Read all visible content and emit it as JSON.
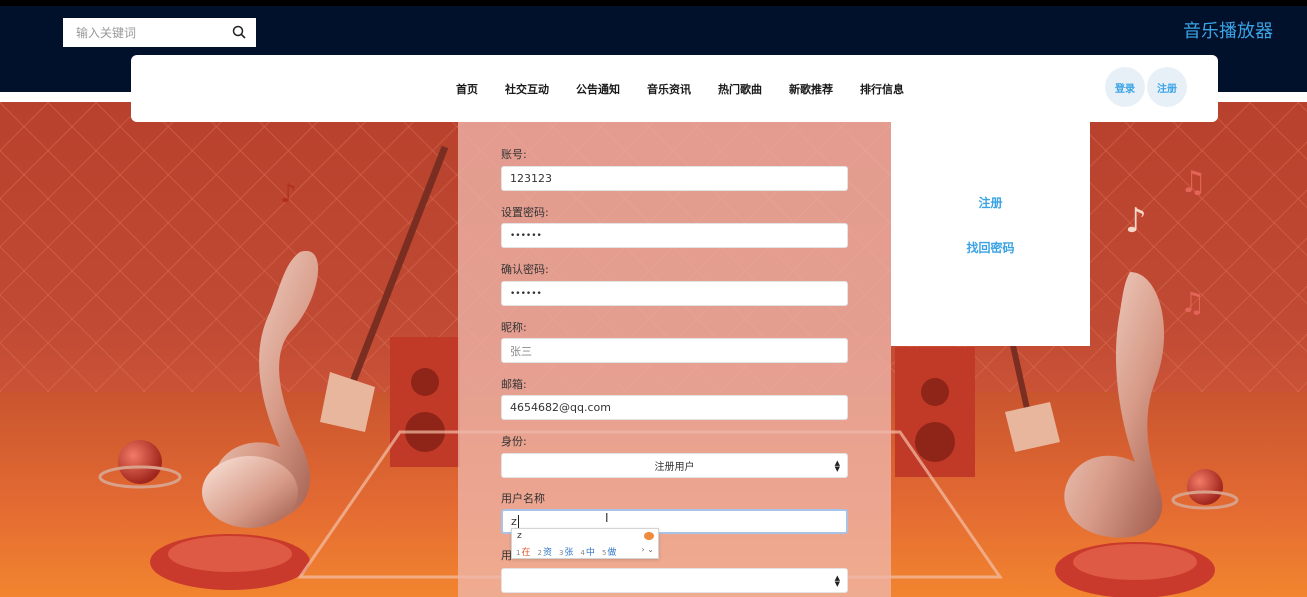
{
  "header": {
    "search_placeholder": "输入关键词",
    "app_title": "音乐播放器",
    "search_icon": "magnifier"
  },
  "nav": {
    "items": [
      "首页",
      "社交互动",
      "公告通知",
      "音乐资讯",
      "热门歌曲",
      "新歌推荐",
      "排行信息"
    ],
    "login_label": "登录",
    "register_label": "注册"
  },
  "dropdown": {
    "items": [
      "注册",
      "找回密码"
    ]
  },
  "form": {
    "account_label": "账号:",
    "account_value": "123123",
    "password_label": "设置密码:",
    "password_value": "••••••",
    "confirm_label": "确认密码:",
    "confirm_value": "••••••",
    "nickname_label": "昵称:",
    "nickname_placeholder": "张三",
    "email_label": "邮箱:",
    "email_value": "4654682@qq.com",
    "identity_label": "身份:",
    "identity_value": "注册用户",
    "username_label": "用户名称",
    "username_value": "z",
    "next_label": "用"
  },
  "ime": {
    "composition": "z",
    "candidates": [
      {
        "num": "1",
        "text": "在"
      },
      {
        "num": "2",
        "text": "资"
      },
      {
        "num": "3",
        "text": "张"
      },
      {
        "num": "4",
        "text": "中"
      },
      {
        "num": "5",
        "text": "做"
      }
    ],
    "nav_glyphs": "› ⌄"
  },
  "colors": {
    "accent": "#3aa3e6",
    "header_bg": "#02112b",
    "panel_overlay": "#eeb6aa"
  }
}
